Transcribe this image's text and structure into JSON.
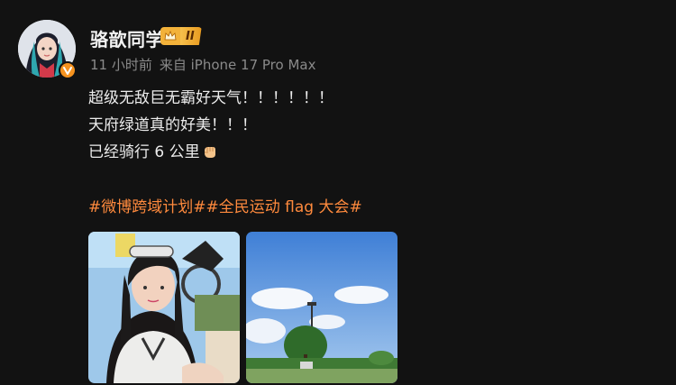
{
  "user": {
    "name": "骆歆同学",
    "level_label": "II",
    "verified_color": "#f6931f",
    "avatar_icon": "avatar-portrait-icon",
    "badge_icon": "crown-icon"
  },
  "meta": {
    "time": "11 小时前",
    "source": "来自 iPhone 17 Pro Max"
  },
  "content": {
    "lines": [
      "超级无敌巨无霸好天气！！！！！！",
      "天府绿道真的好美！！！",
      "已经骑行 6 公里"
    ],
    "trailing_icon": "fist-emoji-icon"
  },
  "tags": [
    "#微博跨域计划#",
    "#全民运动 flag 大会#"
  ],
  "accent_color": "#ff8a3d",
  "photos": [
    {
      "name": "selfie-photo"
    },
    {
      "name": "landscape-photo"
    }
  ]
}
